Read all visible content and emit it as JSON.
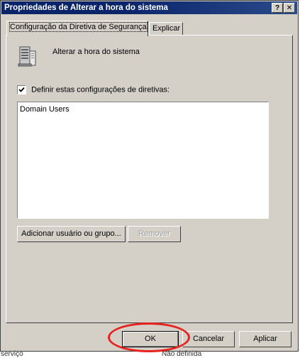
{
  "window": {
    "title": "Propriedades de Alterar a hora do sistema",
    "help_button": "?",
    "close_button": "✕"
  },
  "tabs": [
    {
      "label": "Configuração da Diretiva de Segurança",
      "active": true
    },
    {
      "label": "Explicar",
      "active": false
    }
  ],
  "policy": {
    "name": "Alterar a hora do sistema",
    "icon": "server-policy-icon"
  },
  "define_checkbox": {
    "label": "Definir estas configurações de diretivas:",
    "checked": true
  },
  "users_list": {
    "items": [
      "Domain Users"
    ]
  },
  "buttons": {
    "add": "Adicionar usuário ou grupo...",
    "remove": "Remover",
    "ok": "OK",
    "cancel": "Cancelar",
    "apply": "Aplicar"
  },
  "background": {
    "left_text": "serviço",
    "right_text": "Não definida"
  },
  "colors": {
    "titlebar": "#0a246a",
    "dialog_face": "#d4d0c8",
    "highlight_circle": "#e8231d"
  }
}
